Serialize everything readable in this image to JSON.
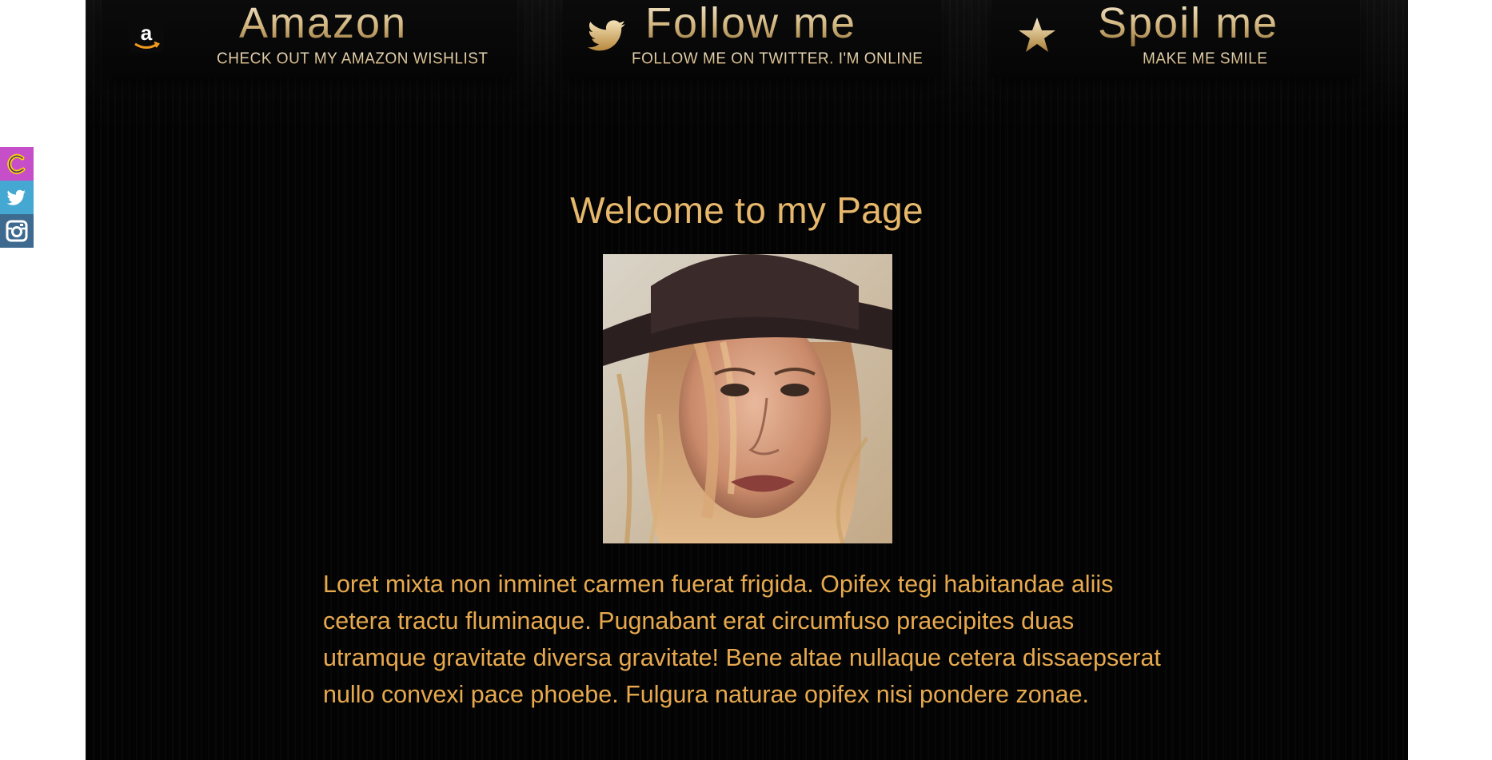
{
  "banners": [
    {
      "icon": "amazon-icon",
      "title": "Amazon",
      "subtitle": "CHECK OUT MY AMAZON WISHLIST"
    },
    {
      "icon": "twitter-bird-icon",
      "title": "Follow me",
      "subtitle": "FOLLOW ME ON TWITTER. I'M ONLINE"
    },
    {
      "icon": "star-icon",
      "title": "Spoil me",
      "subtitle": "MAKE ME SMILE"
    }
  ],
  "main": {
    "title": "Welcome to my Page",
    "intro": "Loret mixta non inminet carmen fuerat frigida. Opifex tegi habitandae aliis cetera tractu fluminaque. Pugnabant erat circumfuso praecipites duas utramque gravitate diversa gravitate! Bene altae nullaque cetera dissaepserat nullo convexi pace phoebe. Fulgura naturae opifex nisi pondere zonae."
  },
  "side_bar": [
    {
      "icon": "c-logo-icon",
      "color": "#c64fc9"
    },
    {
      "icon": "twitter-icon",
      "color": "#45a8d3"
    },
    {
      "icon": "instagram-icon",
      "color": "#3d6a8e"
    }
  ],
  "colors": {
    "background": "#030303",
    "title": "#e7b86b",
    "body_text": "#e7a94e",
    "gold": "#d2b57d"
  }
}
